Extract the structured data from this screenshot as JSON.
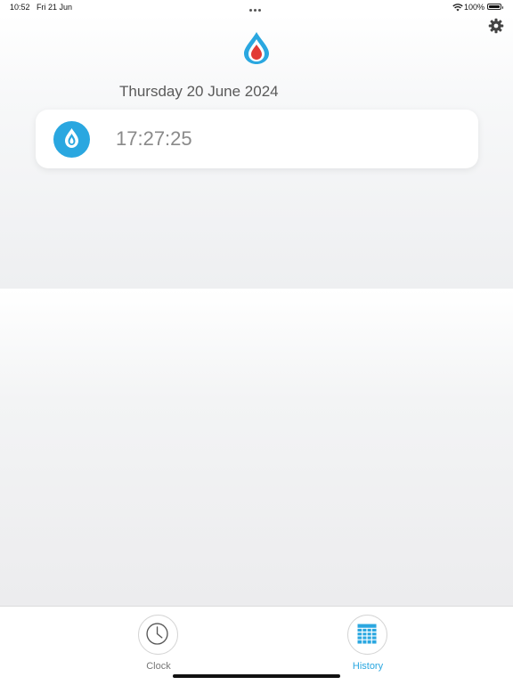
{
  "status_bar": {
    "time": "10:52",
    "date": "Fri 21 Jun",
    "battery": "100%"
  },
  "header": {
    "logo_icon": "flame-drop-logo-icon",
    "settings_icon": "gear-icon"
  },
  "history": {
    "date_heading": "Thursday 20 June 2024",
    "records": [
      {
        "icon": "flame-drop-icon",
        "time": "17:27:25"
      }
    ]
  },
  "tab_bar": {
    "tabs": [
      {
        "label": "Clock",
        "icon": "clock-icon",
        "active": false
      },
      {
        "label": "History",
        "icon": "calendar-icon",
        "active": true
      }
    ]
  },
  "colors": {
    "accent": "#2aa7e0",
    "logo_red": "#e23b36",
    "text_muted": "#8a8a8a"
  }
}
